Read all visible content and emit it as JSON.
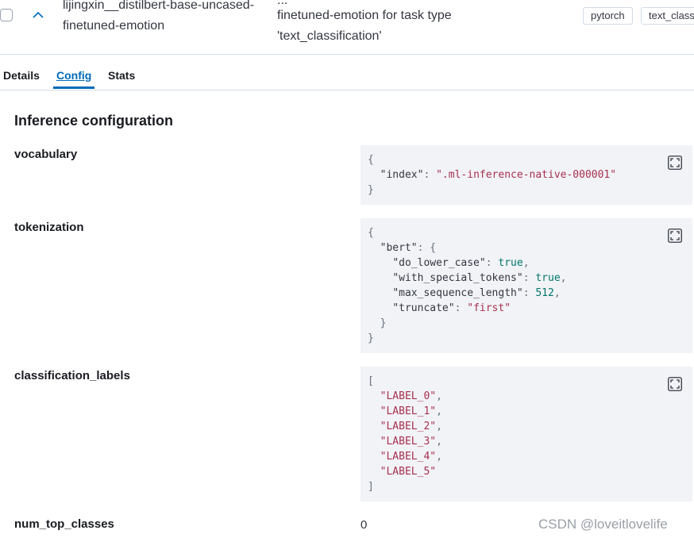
{
  "row": {
    "model_name_line1": "lijingxin__distilbert-base-uncased-",
    "model_name_line2": "finetuned-emotion",
    "desc_line0": "...                              ",
    "desc_line1": "finetuned-emotion for task type",
    "desc_line2": "'text_classification'",
    "badges": [
      "pytorch",
      "text_class"
    ]
  },
  "tabs": [
    {
      "label": "Details"
    },
    {
      "label": "Config"
    },
    {
      "label": "Stats"
    }
  ],
  "section_title": "Inference configuration",
  "fields": {
    "vocabulary": {
      "label": "vocabulary",
      "json": {
        "index_key": "\"index\"",
        "index_value": "\".ml-inference-native-000001\""
      }
    },
    "tokenization": {
      "label": "tokenization",
      "bert_key": "\"bert\"",
      "do_lower_case_key": "\"do_lower_case\"",
      "do_lower_case_value": "true",
      "with_special_tokens_key": "\"with_special_tokens\"",
      "with_special_tokens_value": "true",
      "max_sequence_length_key": "\"max_sequence_length\"",
      "max_sequence_length_value": "512",
      "truncate_key": "\"truncate\"",
      "truncate_value": "\"first\""
    },
    "classification_labels": {
      "label": "classification_labels",
      "values": [
        "\"LABEL_0\"",
        "\"LABEL_1\"",
        "\"LABEL_2\"",
        "\"LABEL_3\"",
        "\"LABEL_4\"",
        "\"LABEL_5\""
      ]
    },
    "num_top_classes": {
      "label": "num_top_classes",
      "value": "0"
    }
  },
  "icons": {
    "expand": "chevron-up-icon",
    "fullscreen": "fullscreen-icon"
  },
  "watermark": "CSDN @loveitlovelife",
  "colors": {
    "accent": "#006bb8",
    "code_bg": "#f1f3f6",
    "string": "#a8304f",
    "literal": "#00766a"
  }
}
